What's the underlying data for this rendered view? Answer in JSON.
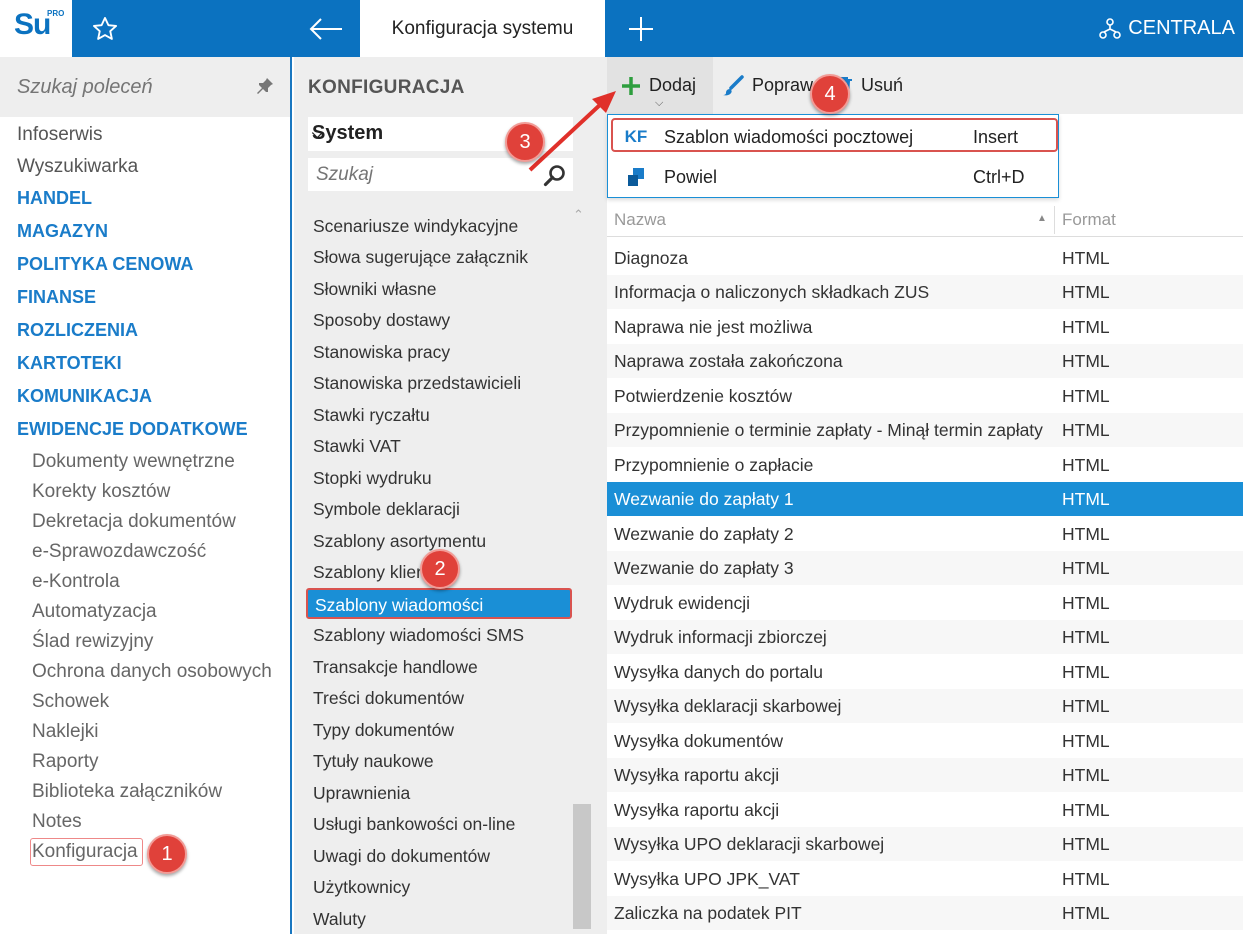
{
  "header": {
    "logo_text": "Su",
    "logo_sup": "PRO",
    "active_tab": "Konfiguracja systemu",
    "company": "CENTRALA"
  },
  "leftnav": {
    "search_placeholder": "Szukaj poleceń",
    "top_items": [
      "Infoserwis",
      "Wyszukiwarka"
    ],
    "sections": [
      "HANDEL",
      "MAGAZYN",
      "POLITYKA CENOWA",
      "FINANSE",
      "ROZLICZENIA",
      "KARTOTEKI",
      "KOMUNIKACJA",
      "EWIDENCJE DODATKOWE"
    ],
    "sub_items": [
      "Dokumenty wewnętrzne",
      "Korekty kosztów",
      "Dekretacja dokumentów",
      "e-Sprawozdawczość",
      "e-Kontrola",
      "Automatyzacja",
      "Ślad rewizyjny",
      "Ochrona danych osobowych",
      "Schowek",
      "Naklejki",
      "Raporty",
      "Biblioteka załączników",
      "Notes",
      "Konfiguracja"
    ]
  },
  "middle": {
    "title": "KONFIGURACJA",
    "select_value": "System",
    "search_placeholder": "Szukaj",
    "items": [
      "Scenariusze windykacyjne",
      "Słowa sugerujące załącznik",
      "Słowniki własne",
      "Sposoby dostawy",
      "Stanowiska pracy",
      "Stanowiska przedstawicieli",
      "Stawki ryczałtu",
      "Stawki VAT",
      "Stopki wydruku",
      "Symbole deklaracji",
      "Szablony asortymentu",
      "Szablony klientów",
      "Szablony wiadomości",
      "Szablony wiadomości SMS",
      "Transakcje handlowe",
      "Treści dokumentów",
      "Typy dokumentów",
      "Tytuły naukowe",
      "Uprawnienia",
      "Usługi bankowości on-line",
      "Uwagi do dokumentów",
      "Użytkownicy",
      "Waluty"
    ],
    "selected_index": 12
  },
  "toolbar": {
    "add_label": "Dodaj",
    "edit_label": "Popraw",
    "delete_label": "Usuń"
  },
  "dropdown": {
    "items": [
      {
        "icon_text": "KF",
        "label": "Szablon wiadomości pocztowej",
        "shortcut": "Insert"
      },
      {
        "icon_text": "",
        "label": "Powiel",
        "shortcut": "Ctrl+D"
      }
    ]
  },
  "grid": {
    "col_name": "Nazwa",
    "col_format": "Format",
    "rows": [
      {
        "name": "Diagnoza",
        "format": "HTML"
      },
      {
        "name": "Informacja o naliczonych składkach ZUS",
        "format": "HTML"
      },
      {
        "name": "Naprawa nie jest możliwa",
        "format": "HTML"
      },
      {
        "name": "Naprawa została zakończona",
        "format": "HTML"
      },
      {
        "name": "Potwierdzenie kosztów",
        "format": "HTML"
      },
      {
        "name": "Przypomnienie o terminie zapłaty - Minął termin zapłaty",
        "format": "HTML"
      },
      {
        "name": "Przypomnienie o zapłacie",
        "format": "HTML"
      },
      {
        "name": "Wezwanie do zapłaty 1",
        "format": "HTML"
      },
      {
        "name": "Wezwanie do zapłaty 2",
        "format": "HTML"
      },
      {
        "name": "Wezwanie do zapłaty 3",
        "format": "HTML"
      },
      {
        "name": "Wydruk ewidencji",
        "format": "HTML"
      },
      {
        "name": "Wydruk informacji zbiorczej",
        "format": "HTML"
      },
      {
        "name": "Wysyłka danych do portalu",
        "format": "HTML"
      },
      {
        "name": "Wysyłka deklaracji skarbowej",
        "format": "HTML"
      },
      {
        "name": "Wysyłka dokumentów",
        "format": "HTML"
      },
      {
        "name": "Wysyłka raportu akcji",
        "format": "HTML"
      },
      {
        "name": "Wysyłka raportu akcji",
        "format": "HTML"
      },
      {
        "name": "Wysyłka UPO deklaracji skarbowej",
        "format": "HTML"
      },
      {
        "name": "Wysyłka UPO JPK_VAT",
        "format": "HTML"
      },
      {
        "name": "Zaliczka na podatek PIT",
        "format": "HTML"
      }
    ],
    "selected_index": 7
  },
  "callouts": [
    "1",
    "2",
    "3",
    "4"
  ],
  "colors": {
    "brand": "#0b72c0",
    "accent": "#1a8fd6",
    "callout": "#e0413a"
  }
}
